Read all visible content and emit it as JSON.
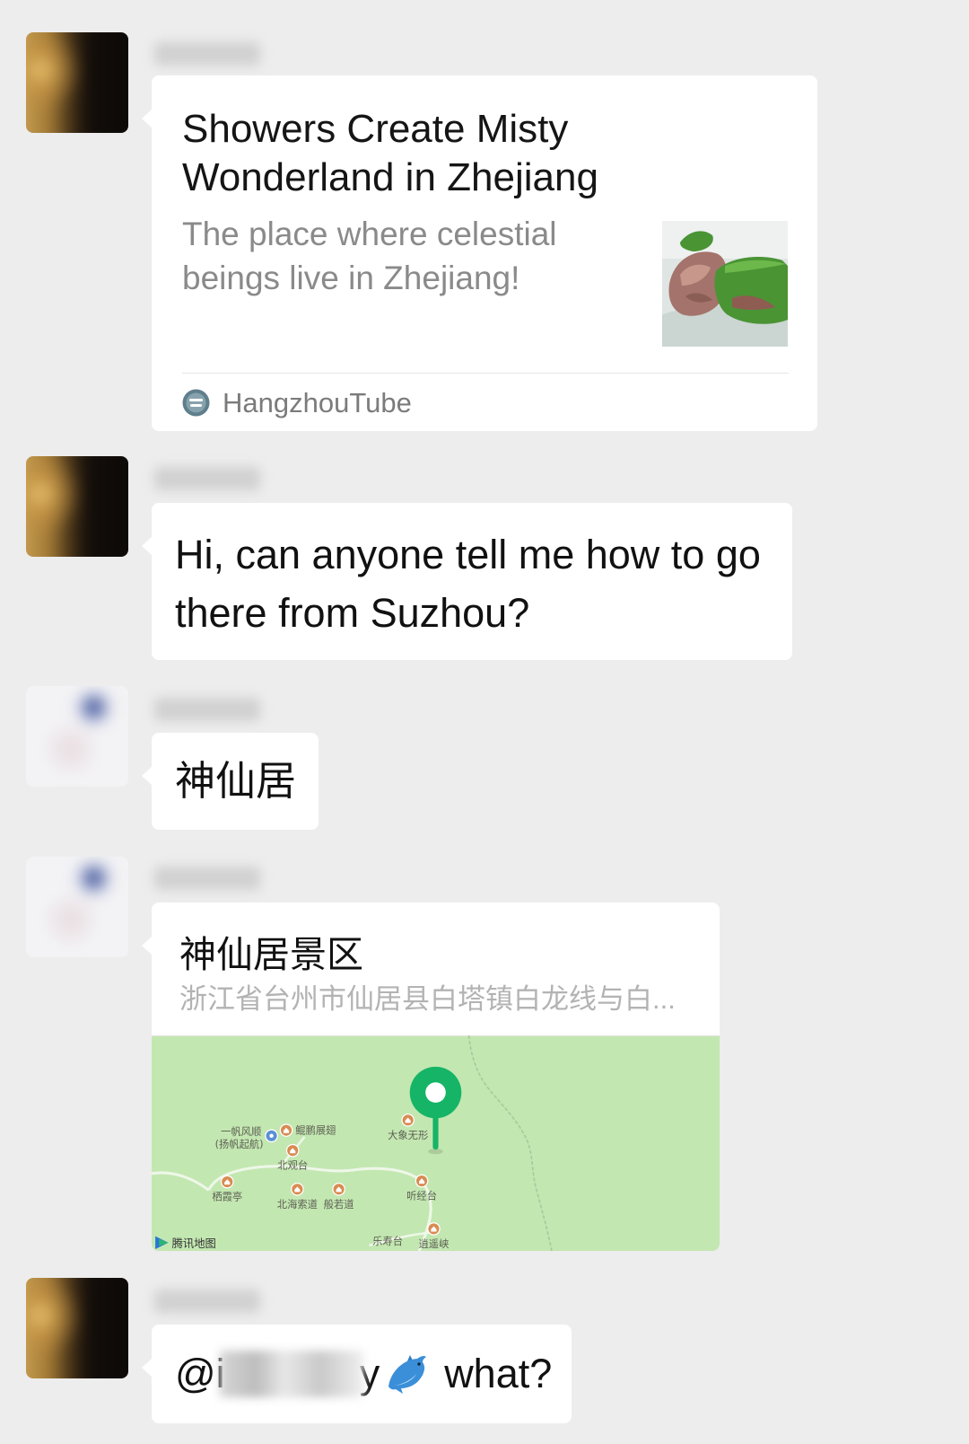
{
  "colors": {
    "background": "#ededed",
    "bubble": "#ffffff",
    "primary_text": "#111111",
    "secondary_text": "#8a8a8a",
    "address_text": "#b3b3b3",
    "map_land": "#c3e7b1",
    "map_pin": "#16b466",
    "poi_marker": "#d98b52"
  },
  "messages": [
    {
      "title": "Showers Create Misty Wonderland in Zhejiang",
      "description": "The place where celestial beings live in Zhejiang!",
      "source_icon": "hangzhoutube-logo-icon",
      "source": "HangzhouTube"
    },
    {
      "text": "Hi, can anyone tell me how to go there from Suzhou?"
    },
    {
      "text": "神仙居"
    },
    {
      "name": "神仙居景区",
      "address": "浙江省台州市仙居县白塔镇白龙线与白...",
      "map": {
        "provider": "腾讯地图",
        "provider_icon": "tencent-maps-logo-icon",
        "pin_icon": "location-pin-icon",
        "pois": [
          {
            "name": "一帆风顺",
            "sub": "(扬帆起航)"
          },
          {
            "name": "鲲鹏展翅"
          },
          {
            "name": "北观台"
          },
          {
            "name": "栖霞亭"
          },
          {
            "name": "北海索道"
          },
          {
            "name": "般若道"
          },
          {
            "name": "大象无形"
          },
          {
            "name": "听经台"
          },
          {
            "name": "乐寿台"
          },
          {
            "name": "逍遥峡"
          }
        ]
      }
    },
    {
      "mention_start": "@i",
      "mention_end": "y",
      "emoji_icon": "dolphin-icon",
      "text": "what?"
    }
  ]
}
